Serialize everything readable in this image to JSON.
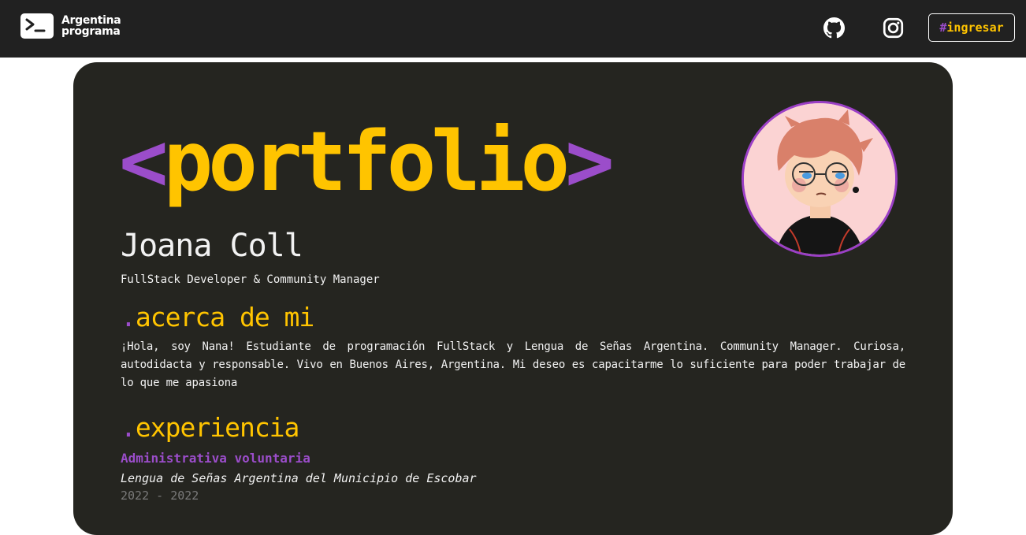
{
  "nav": {
    "logo_line1": "Argentina",
    "logo_line2": "programa",
    "github_icon": "github-icon",
    "instagram_icon": "instagram-icon",
    "login_hash": "#",
    "login_label": "ingresar"
  },
  "hero": {
    "bracket_open": "<",
    "title_word": "portfolio",
    "bracket_close": ">",
    "name": "Joana Coll",
    "role": "FullStack Developer & Community Manager"
  },
  "about": {
    "dot": ".",
    "heading": "acerca de mi",
    "text": "¡Hola, soy Nana! Estudiante de programación FullStack y Lengua de Señas Argentina. Community Manager. Curiosa, autodidacta y responsable. Vivo en Buenos Aires, Argentina. Mi deseo es capacitarme lo suficiente para poder trabajar de lo que me apasiona"
  },
  "experience": {
    "dot": ".",
    "heading": "experiencia",
    "items": [
      {
        "title": "Administrativa voluntaria",
        "organization": "Lengua de Señas Argentina del Municipio de Escobar",
        "dates": "2022 - 2022"
      }
    ]
  },
  "colors": {
    "navbar": "#212121",
    "card": "#252520",
    "accent_yellow": "#ffc400",
    "accent_purple": "#9b4dca",
    "avatar_border": "#9b3fc6"
  }
}
